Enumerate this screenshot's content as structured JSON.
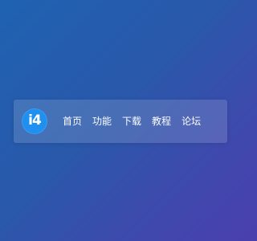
{
  "brand": {
    "logo_text": "i4"
  },
  "nav": {
    "items": [
      {
        "label": "首页"
      },
      {
        "label": "功能"
      },
      {
        "label": "下载"
      },
      {
        "label": "教程"
      },
      {
        "label": "论坛"
      }
    ]
  },
  "colors": {
    "background_start": "#1f62b2",
    "background_end": "#4a3fae",
    "logo_bg": "#1f8ff0",
    "text": "#ffffff"
  }
}
